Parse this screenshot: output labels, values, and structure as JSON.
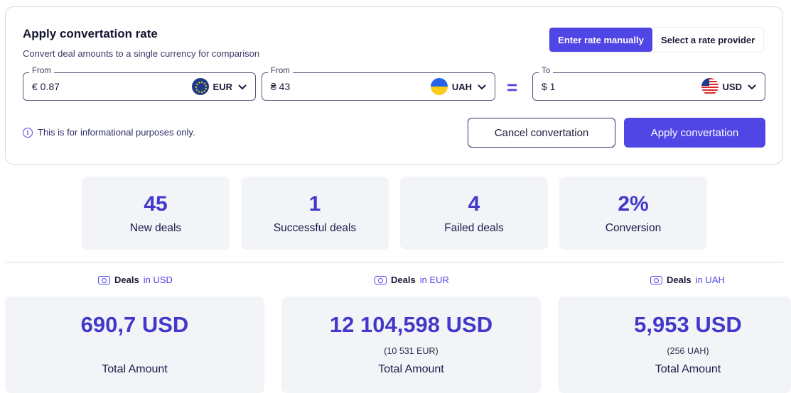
{
  "header": {
    "title": "Apply convertation rate",
    "subtitle": "Convert deal amounts to a single currency for comparison"
  },
  "mode_toggle": {
    "manual_label": "Enter rate manually",
    "provider_label": "Select a rate provider",
    "active": "manual"
  },
  "rate_fields": [
    {
      "legend": "From",
      "value": "€ 0.87",
      "currency": "EUR",
      "flag": "eu-flag-icon"
    },
    {
      "legend": "From",
      "value": "₴ 43",
      "currency": "UAH",
      "flag": "ua-flag-icon"
    },
    {
      "legend": "To",
      "value": "$ 1",
      "currency": "USD",
      "flag": "us-flag-icon"
    }
  ],
  "equals_symbol": "=",
  "info_text": "This is for informational purposes only.",
  "actions": {
    "cancel_label": "Cancel convertation",
    "apply_label": "Apply convertation"
  },
  "stats": [
    {
      "value": "45",
      "label": "New deals"
    },
    {
      "value": "1",
      "label": "Successful deals"
    },
    {
      "value": "4",
      "label": "Failed deals"
    },
    {
      "value": "2%",
      "label": "Conversion"
    }
  ],
  "deal_totals": [
    {
      "heading": "Deals",
      "in_currency": "in USD",
      "amount": "690,7 USD",
      "original": "",
      "label": "Total Amount"
    },
    {
      "heading": "Deals",
      "in_currency": "in EUR",
      "amount": "12 104,598 USD",
      "original": "(10 531 EUR)",
      "label": "Total Amount"
    },
    {
      "heading": "Deals",
      "in_currency": "in UAH",
      "amount": "5,953 USD",
      "original": "(256 UAH)",
      "label": "Total Amount"
    }
  ],
  "colors": {
    "accent": "#4f46e5",
    "accent_text": "#4338ca",
    "card_bg": "#f2f4f7",
    "border": "#d9dbe3"
  }
}
